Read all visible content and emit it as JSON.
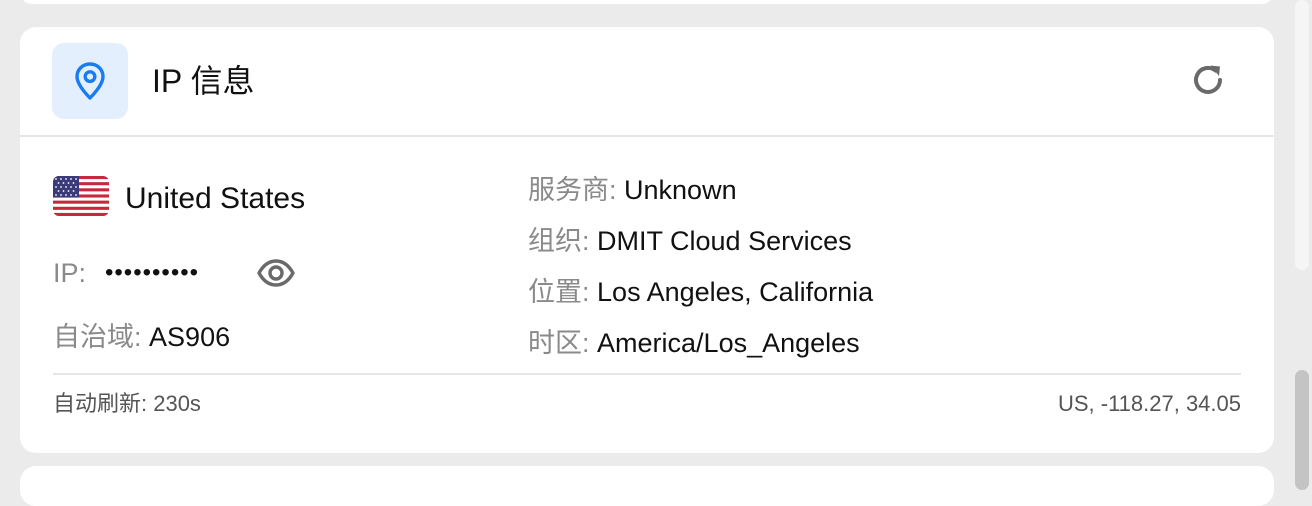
{
  "card": {
    "title": "IP 信息",
    "icon": "map-pin-icon",
    "refresh_icon": "refresh-icon"
  },
  "location": {
    "country": "United States",
    "flag": "us-flag-icon"
  },
  "ip": {
    "label": "IP:",
    "masked_value": "••••••••••",
    "toggle_icon": "eye-icon"
  },
  "asn": {
    "label": "自治域:",
    "value": "AS906"
  },
  "details": {
    "isp_label": "服务商:",
    "isp_value": "Unknown",
    "org_label": "组织:",
    "org_value": "DMIT Cloud Services",
    "location_label": "位置:",
    "location_value": "Los Angeles, California",
    "timezone_label": "时区:",
    "timezone_value": "America/Los_Angeles"
  },
  "footer": {
    "auto_refresh": "自动刷新: 230s",
    "coords": "US, -118.27, 34.05"
  },
  "colors": {
    "accent": "#1a7cf3",
    "icon_tile_bg": "#e3effd",
    "muted_text": "#8a8a8a",
    "background": "#ebebeb"
  }
}
